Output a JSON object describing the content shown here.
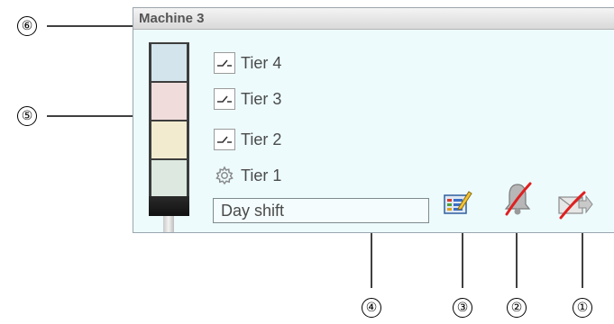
{
  "panel": {
    "title": "Machine 3",
    "tiers": [
      {
        "label": "Tier 4",
        "icon": "switch-icon",
        "color": "#d3e4ec"
      },
      {
        "label": "Tier 3",
        "icon": "switch-icon",
        "color": "#f1dcdc"
      },
      {
        "label": "Tier 2",
        "icon": "switch-icon",
        "color": "#f3ebcf"
      },
      {
        "label": "Tier 1",
        "icon": "gear-icon",
        "color": "#dde9e0"
      }
    ],
    "shift_value": "Day shift",
    "actions": [
      {
        "name": "edit-report-icon"
      },
      {
        "name": "alarm-bell-disabled-icon"
      },
      {
        "name": "send-mail-disabled-icon"
      }
    ]
  },
  "callouts": [
    "①",
    "②",
    "③",
    "④",
    "⑤",
    "⑥"
  ]
}
